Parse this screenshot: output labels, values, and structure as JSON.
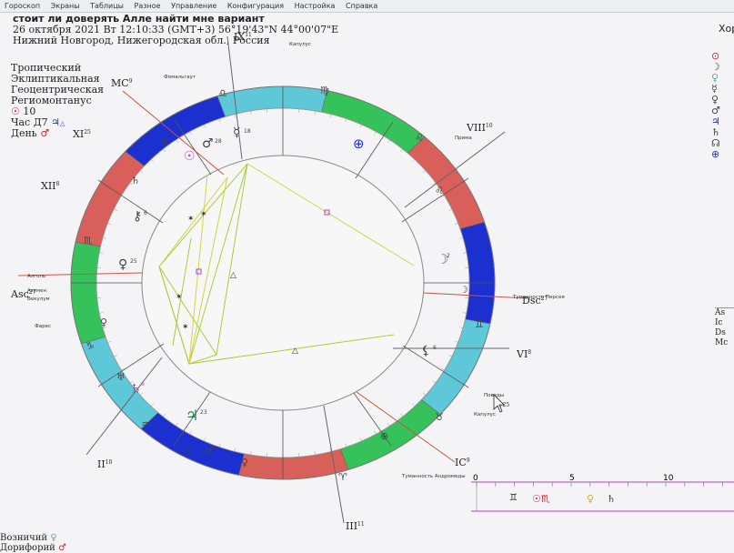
{
  "menu": [
    "Гороскоп",
    "Экраны",
    "Таблицы",
    "Разное",
    "Управление",
    "Конфигурация",
    "Настройка",
    "Справка"
  ],
  "header": {
    "title": "стоит ли доверять Алле найти мне вариант",
    "datetime": "26 октября 2021   Вт   12:10:33 (GMT+3) 56°19'43\"N  44°00'07\"E",
    "place": "Нижний Новгород, Нижегородская обл., Россия"
  },
  "params": {
    "zodiac": "Тропический",
    "coords": "Эклиптикальная",
    "center": "Геоцентрическая",
    "houses": "Региомонтанус",
    "sun_day": "10",
    "hour_label": "Час Д7",
    "day_label": "День"
  },
  "houses": {
    "asc": "Asc",
    "asc_deg": "27",
    "mc": "MC",
    "mc_deg": "9",
    "dsc": "Dsc",
    "dsc_deg": "27",
    "ic": "IC",
    "ic_deg": "9",
    "h2": "II",
    "h2_deg": "10",
    "h3": "III",
    "h3_deg": "11",
    "h5": "V",
    "h5_deg": "25",
    "h6": "VI",
    "h6_deg": "8",
    "h8": "VIII",
    "h8_deg": "10",
    "h9": "IX",
    "h9_deg": "11",
    "h11": "XI",
    "h11_deg": "25",
    "h12": "XII",
    "h12_deg": "8"
  },
  "stars": {
    "algol": "Алголь",
    "capulus_top": "Капулус",
    "fomalhaut": "Фомальгаут",
    "prima": "Прима",
    "asumen": "Азумен",
    "vekulum": "Векулум",
    "fares": "Фарес",
    "tum_persei": "Туманность Персея",
    "povedy": "Поведы",
    "capulus": "Капулус",
    "tum_andromeda": "Туманность Андромеды"
  },
  "planet_degrees": {
    "mercury": "18",
    "mars": "28",
    "chiron": "6",
    "venus": "25",
    "saturn": "6",
    "jupiter": "23",
    "lilith": "6",
    "moon": "2"
  },
  "right_panel": {
    "label": "Хор",
    "mini_table": [
      "As",
      "Ic",
      "Ds",
      "Mc"
    ]
  },
  "mini_strip": {
    "ticks": [
      "0",
      "5",
      "10"
    ]
  },
  "bottom": {
    "item1": "Возничий",
    "item2": "Дорифорий"
  },
  "colors": {
    "fire": "#d9605a",
    "earth": "#36c25a",
    "air": "#5ec8d8",
    "water": "#1c2fcf",
    "aspect_yellow": "#d4d243",
    "aspect_green": "#a9cd3c",
    "cusp_line": "#c8553c",
    "mag": "#b43fc6"
  }
}
